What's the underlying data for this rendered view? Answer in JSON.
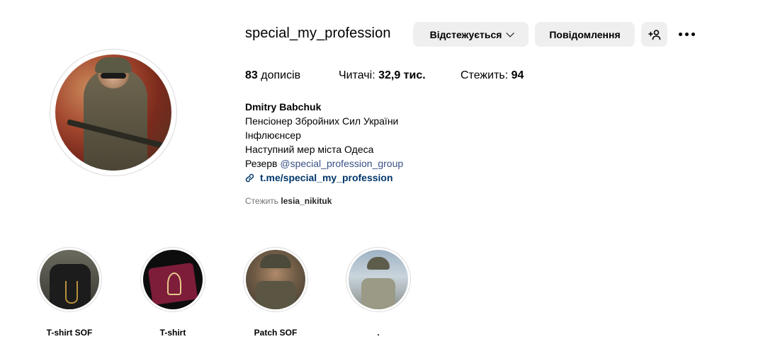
{
  "profile": {
    "username": "special_my_profession",
    "buttons": {
      "follow": "Відстежується",
      "message": "Повідомлення"
    },
    "stats": {
      "posts_count": "83",
      "posts_label": "дописів",
      "followers_label": "Читачі:",
      "followers_count": "32,9 тис.",
      "following_label": "Стежить:",
      "following_count": "94"
    },
    "bio": {
      "name": "Dmitry Babchuk",
      "line1": "Пенсіонер Збройних Сил України",
      "line2": "Інфлюєнсер",
      "line3": "Наступний мер міста Одеса",
      "line4_prefix": "Резерв ",
      "line4_mention": "@special_profession_group",
      "link": "t.me/special_my_profession"
    },
    "followed_by": {
      "prefix": "Стежить",
      "user": "lesia_nikituk"
    }
  },
  "highlights": [
    {
      "label": "T-shirt SOF"
    },
    {
      "label": "T-shirt"
    },
    {
      "label": "Patch SOF"
    },
    {
      "label": "."
    }
  ]
}
